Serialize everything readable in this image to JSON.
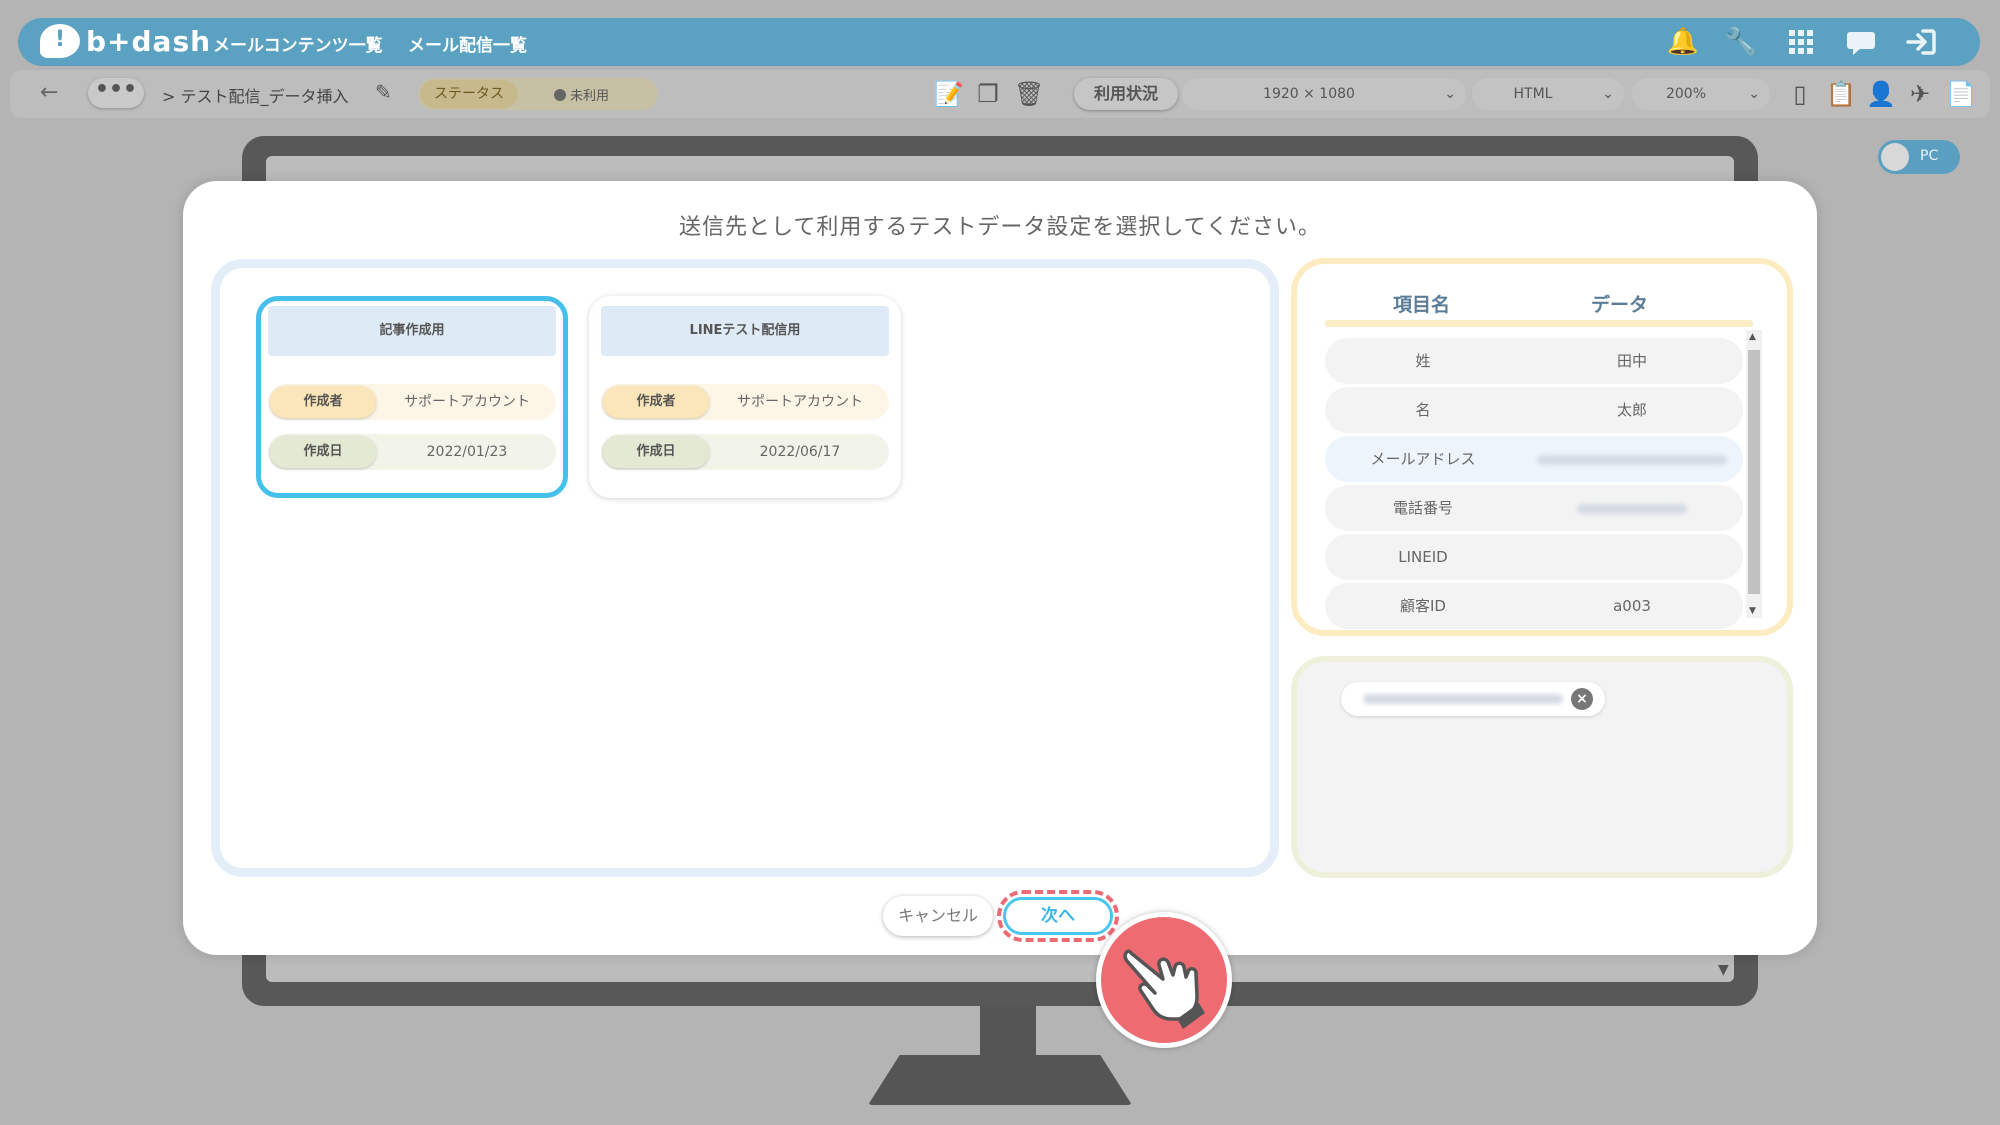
{
  "app": {
    "logo": "b+dash",
    "nav": [
      "メールコンテンツ一覧",
      "メール配信一覧"
    ],
    "top_icons": [
      "bell-icon",
      "wrench-icon",
      "grid-icon",
      "chat-icon",
      "logout-icon"
    ]
  },
  "toolbar": {
    "back": "←",
    "more": "•••",
    "breadcrumb": "> テスト配信_データ挿入",
    "status_label": "ステータス",
    "status_value": "未利用",
    "usage_label": "利用状況",
    "resolution": "1920 × 1080",
    "format": "HTML",
    "zoom": "200%",
    "device_toggle": "PC"
  },
  "modal": {
    "title": "送信先として利用するテストデータ設定を選択してください。",
    "cards": [
      {
        "title": "記事作成用",
        "author_label": "作成者",
        "author": "サポートアカウント",
        "date_label": "作成日",
        "date": "2022/01/23",
        "selected": true
      },
      {
        "title": "LINEテスト配信用",
        "author_label": "作成者",
        "author": "サポートアカウント",
        "date_label": "作成日",
        "date": "2022/06/17",
        "selected": false
      }
    ],
    "table": {
      "col_field": "項目名",
      "col_data": "データ",
      "rows": [
        {
          "field": "姓",
          "value": "田中"
        },
        {
          "field": "名",
          "value": "太郎"
        },
        {
          "field": "メールアドレス",
          "value": ""
        },
        {
          "field": "電話番号",
          "value": ""
        },
        {
          "field": "LINEID",
          "value": ""
        },
        {
          "field": "顧客ID",
          "value": "a003"
        }
      ]
    },
    "cancel_label": "キャンセル",
    "next_label": "次へ"
  }
}
